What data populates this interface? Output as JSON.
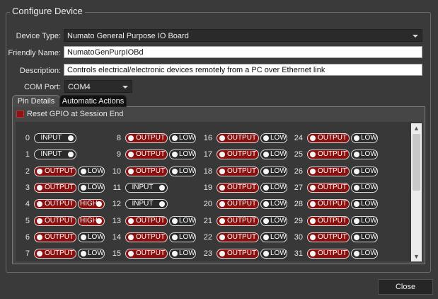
{
  "group_title": "Configure Device",
  "fields": {
    "device_type_label": "Device Type:",
    "device_type_value": "Numato General Purpose IO Board",
    "friendly_name_label": "Friendly Name:",
    "friendly_name_value": "NumatoGenPurpIOBd",
    "description_label": "Description:",
    "description_value": "Controls electrical/electronic devices remotely from a PC over Ethernet link",
    "com_port_label": "COM Port:",
    "com_port_value": "COM4"
  },
  "tabs": [
    {
      "label": "Pin Details",
      "active": true
    },
    {
      "label": "Automatic Actions",
      "active": false
    }
  ],
  "reset_gpio_label": "Reset GPIO at Session End",
  "reset_gpio_checked": true,
  "pins": [
    {
      "num": "0",
      "dir": "INPUT"
    },
    {
      "num": "1",
      "dir": "INPUT"
    },
    {
      "num": "2",
      "dir": "OUTPUT",
      "state": "LOW"
    },
    {
      "num": "3",
      "dir": "OUTPUT",
      "state": "LOW"
    },
    {
      "num": "4",
      "dir": "OUTPUT",
      "state": "HIGH"
    },
    {
      "num": "5",
      "dir": "OUTPUT",
      "state": "HIGH"
    },
    {
      "num": "6",
      "dir": "OUTPUT",
      "state": "LOW"
    },
    {
      "num": "7",
      "dir": "OUTPUT",
      "state": "LOW"
    },
    {
      "num": "8",
      "dir": "OUTPUT",
      "state": "LOW"
    },
    {
      "num": "9",
      "dir": "OUTPUT",
      "state": "LOW"
    },
    {
      "num": "10",
      "dir": "OUTPUT",
      "state": "LOW"
    },
    {
      "num": "11",
      "dir": "INPUT"
    },
    {
      "num": "12",
      "dir": "INPUT"
    },
    {
      "num": "13",
      "dir": "OUTPUT",
      "state": "LOW"
    },
    {
      "num": "14",
      "dir": "OUTPUT",
      "state": "LOW"
    },
    {
      "num": "15",
      "dir": "OUTPUT",
      "state": "LOW"
    },
    {
      "num": "16",
      "dir": "OUTPUT",
      "state": "LOW"
    },
    {
      "num": "17",
      "dir": "OUTPUT",
      "state": "LOW"
    },
    {
      "num": "18",
      "dir": "OUTPUT",
      "state": "LOW"
    },
    {
      "num": "19",
      "dir": "OUTPUT",
      "state": "LOW"
    },
    {
      "num": "20",
      "dir": "OUTPUT",
      "state": "LOW"
    },
    {
      "num": "21",
      "dir": "OUTPUT",
      "state": "LOW"
    },
    {
      "num": "22",
      "dir": "OUTPUT",
      "state": "LOW"
    },
    {
      "num": "23",
      "dir": "OUTPUT",
      "state": "LOW"
    },
    {
      "num": "24",
      "dir": "OUTPUT",
      "state": "LOW"
    },
    {
      "num": "25",
      "dir": "OUTPUT",
      "state": "LOW"
    },
    {
      "num": "26",
      "dir": "OUTPUT",
      "state": "LOW"
    },
    {
      "num": "27",
      "dir": "OUTPUT",
      "state": "LOW"
    },
    {
      "num": "28",
      "dir": "OUTPUT",
      "state": "LOW"
    },
    {
      "num": "29",
      "dir": "OUTPUT",
      "state": "LOW"
    },
    {
      "num": "30",
      "dir": "OUTPUT",
      "state": "LOW"
    },
    {
      "num": "31",
      "dir": "OUTPUT",
      "state": "LOW"
    }
  ],
  "icons": {
    "dropdown": "chevron-down-icon",
    "scroll_up": "chevron-up-icon",
    "scroll_down": "chevron-down-icon"
  },
  "colors": {
    "output_red": "#8a1010",
    "background": "#3a3a3a"
  },
  "close_label": "Close"
}
